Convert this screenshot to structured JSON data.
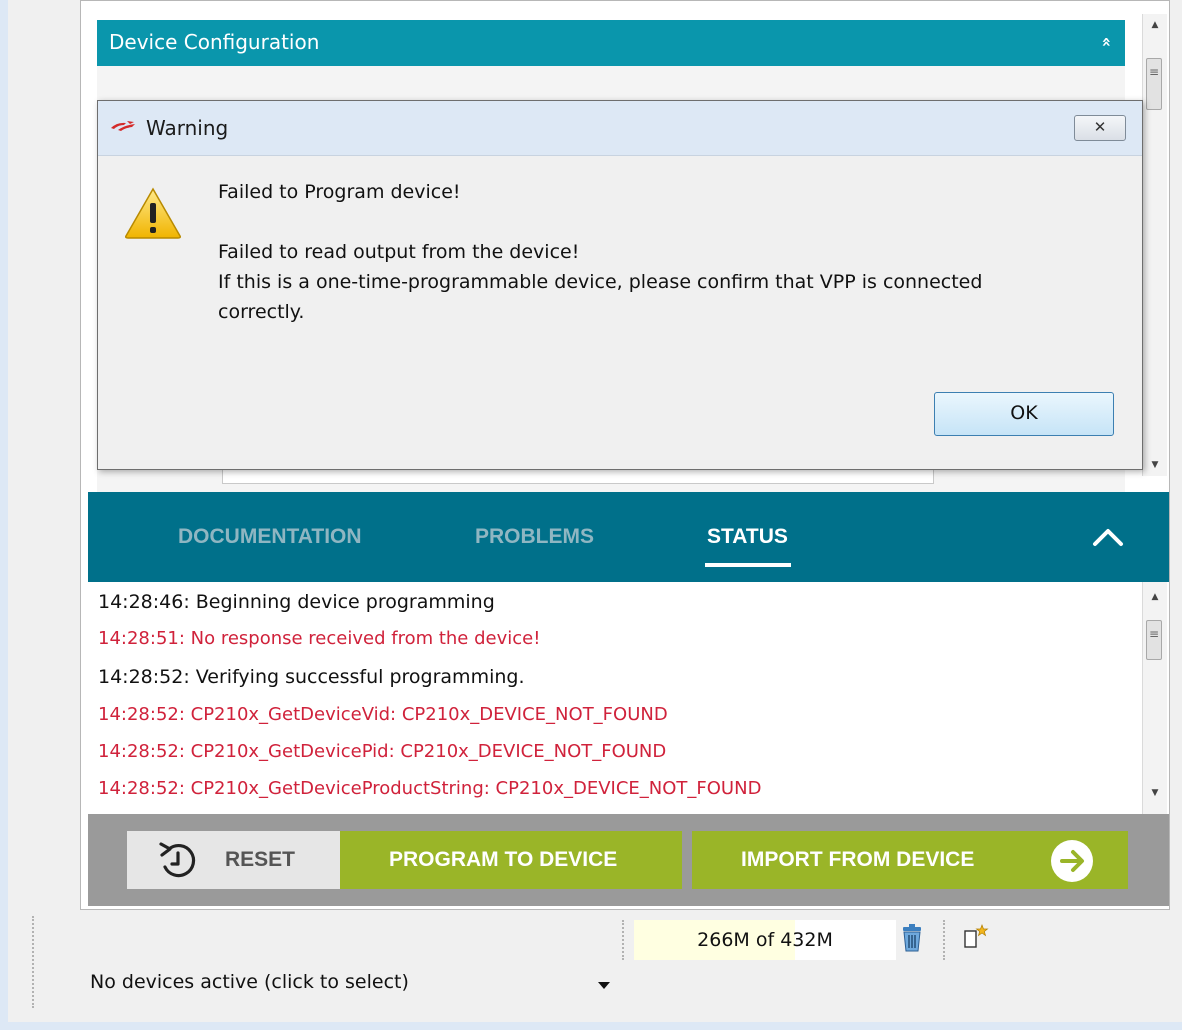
{
  "config": {
    "header_title": "Device Configuration",
    "collapse_glyph": "»"
  },
  "dialog": {
    "title": "Warning",
    "close_glyph": "✕",
    "message_title": "Failed to Program device!",
    "message_lines": [
      "Failed to read output from the device!",
      "If this is a one-time-programmable device, please confirm that VPP is connected",
      "correctly."
    ],
    "ok_label": "OK"
  },
  "tabs": [
    {
      "label": "DOCUMENTATION",
      "active": false
    },
    {
      "label": "PROBLEMS",
      "active": false
    },
    {
      "label": "STATUS",
      "active": true
    }
  ],
  "status_log": [
    {
      "text": "14:28:46: Beginning device programming",
      "level": "info"
    },
    {
      "text": "14:28:51: No response received from the device!",
      "level": "error"
    },
    {
      "text": "14:28:52: Verifying successful programming.",
      "level": "info"
    },
    {
      "text": "14:28:52: CP210x_GetDeviceVid: CP210x_DEVICE_NOT_FOUND",
      "level": "error"
    },
    {
      "text": "14:28:52: CP210x_GetDevicePid: CP210x_DEVICE_NOT_FOUND",
      "level": "error"
    },
    {
      "text": "14:28:52: CP210x_GetDeviceProductString: CP210x_DEVICE_NOT_FOUND",
      "level": "error"
    }
  ],
  "actions": {
    "reset_label": "RESET",
    "program_label": "PROGRAM TO DEVICE",
    "import_label": "IMPORT FROM DEVICE"
  },
  "status_bar": {
    "heap_label": "266M of 432M",
    "heap_used_mb": 266,
    "heap_total_mb": 432,
    "device_selector": "No devices active (click to select)"
  },
  "colors": {
    "header_teal": "#0a96ac",
    "tab_bar": "#00708a",
    "action_green": "#9ab528",
    "error_red": "#d0223b"
  }
}
